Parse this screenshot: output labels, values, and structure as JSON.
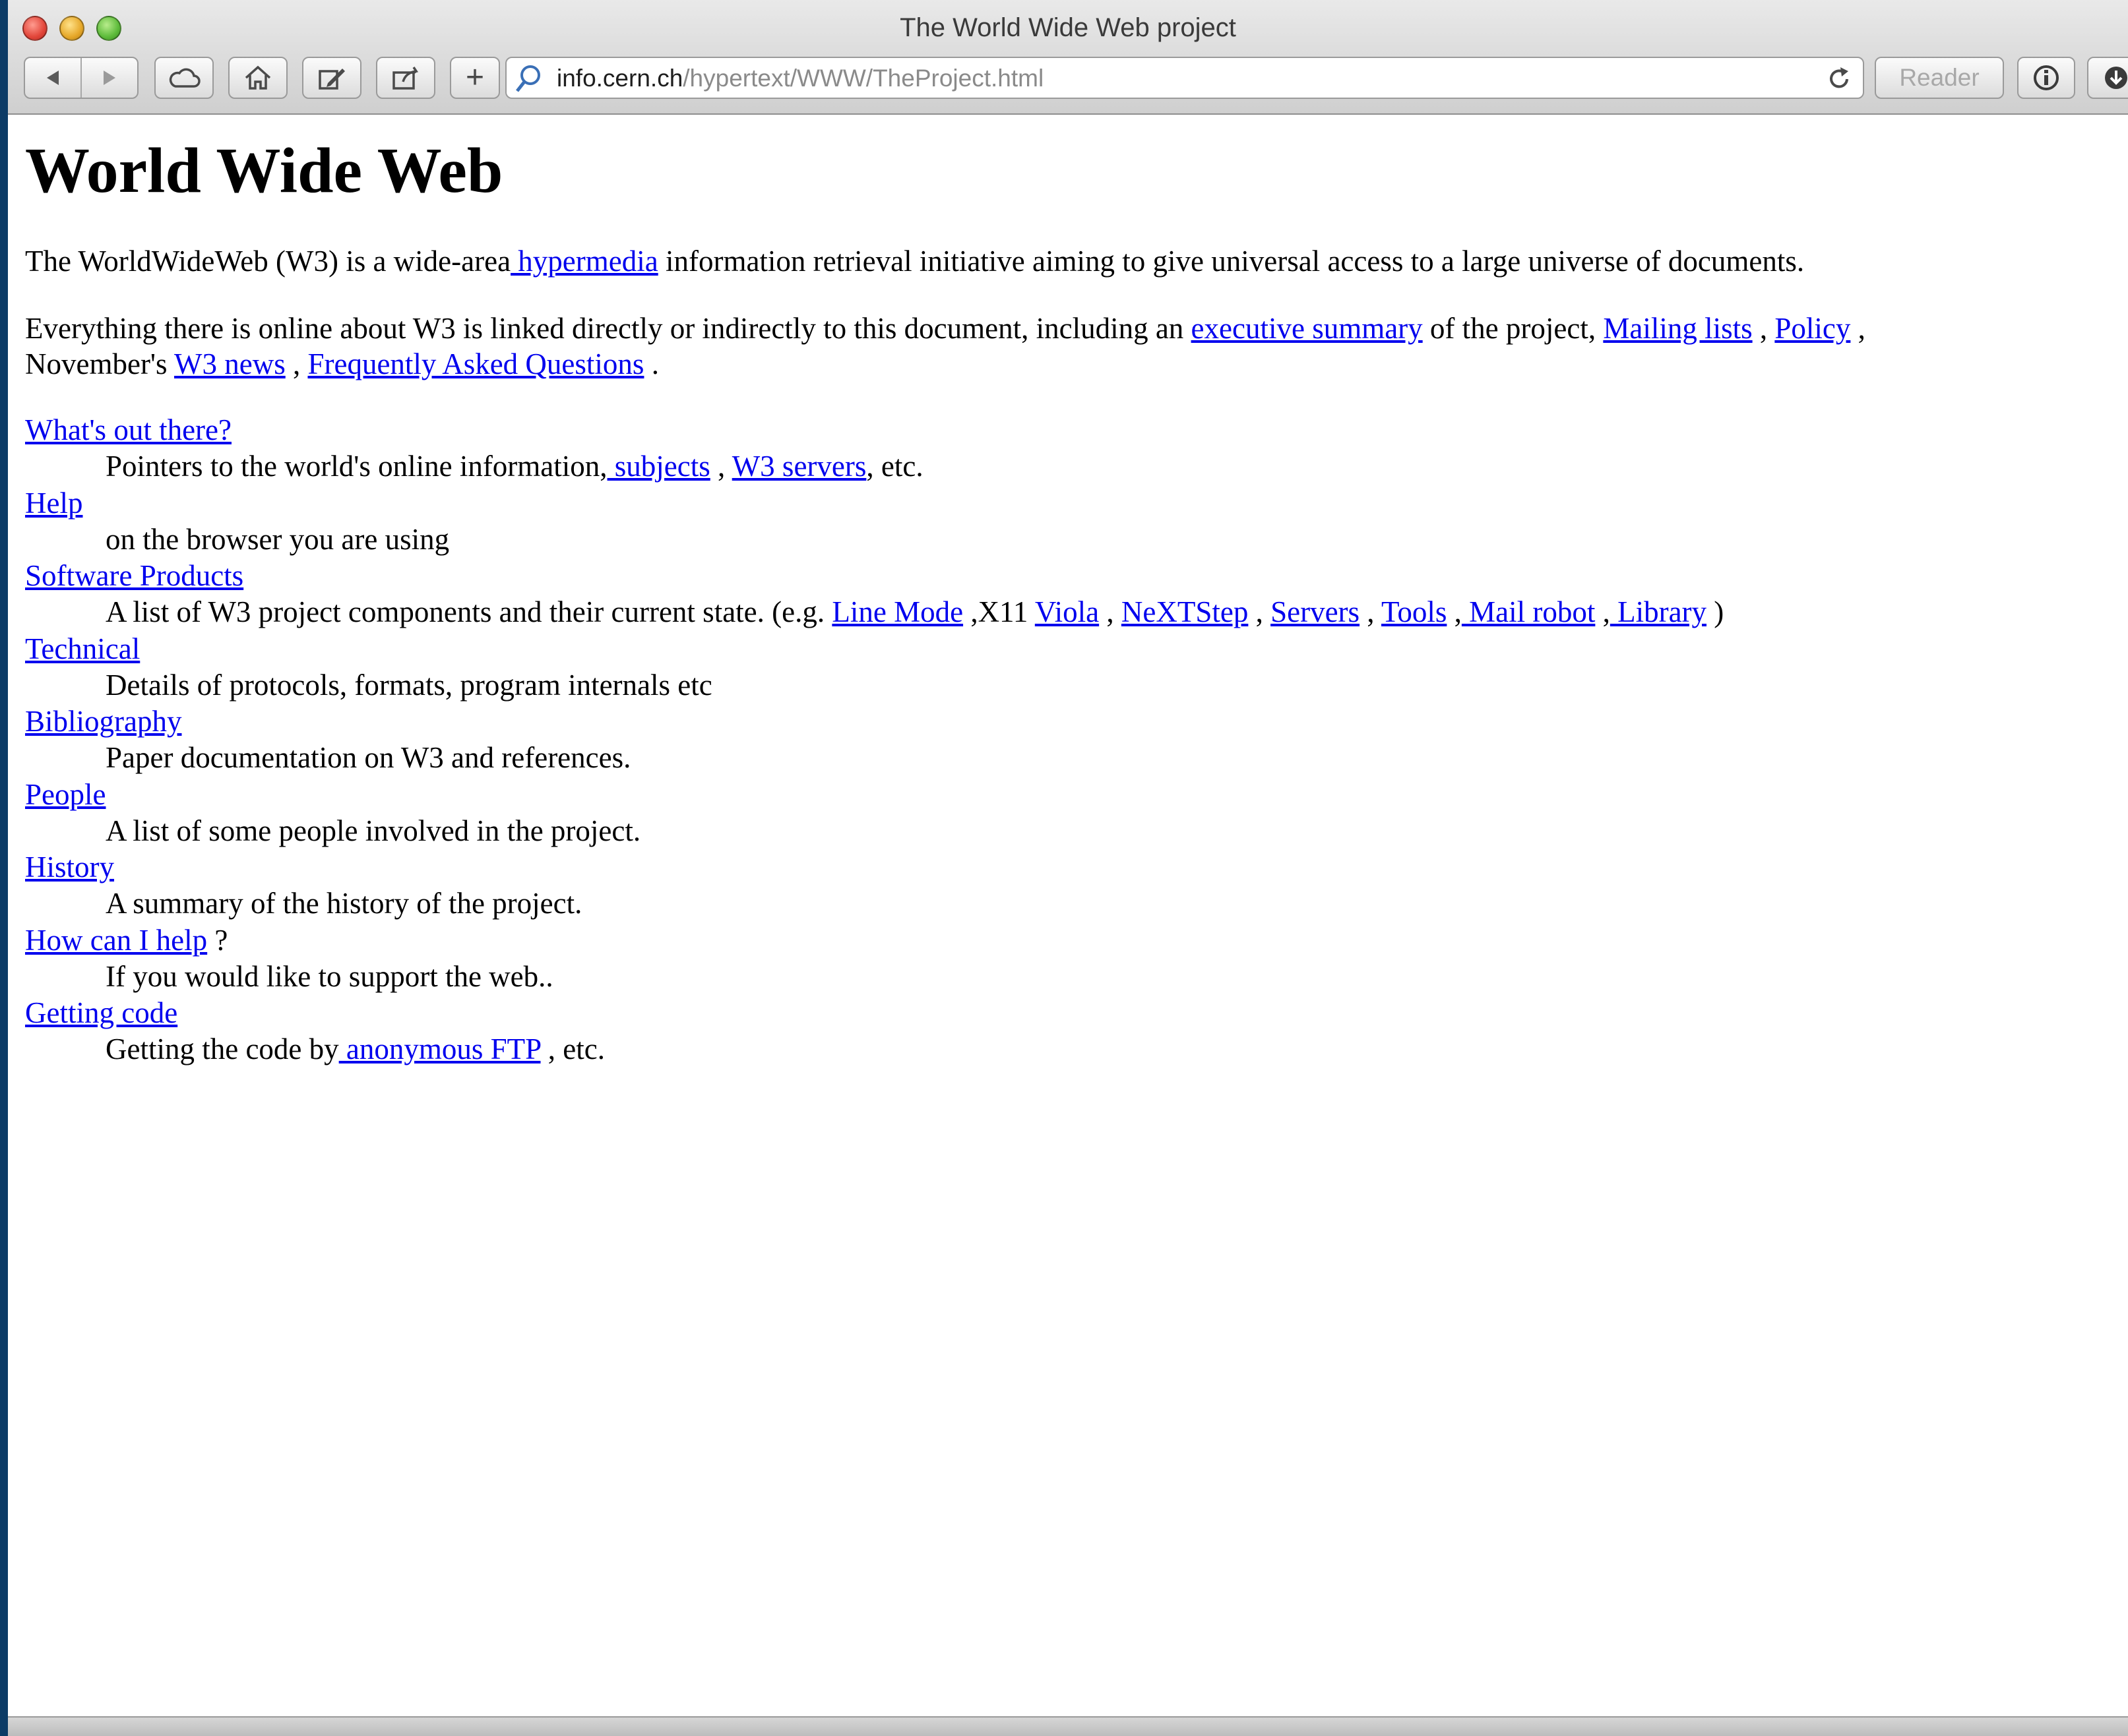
{
  "window": {
    "title": "The World Wide Web project"
  },
  "toolbar": {
    "address_host": "info.cern.ch",
    "address_path": "/hypertext/WWW/TheProject.html",
    "reader_label": "Reader",
    "add_label": "+"
  },
  "page": {
    "heading": "World Wide Web",
    "intro": {
      "before": "The WorldWideWeb (W3) is a wide-area",
      "link": " hypermedia",
      "after": " information retrieval initiative aiming to give universal access to a large universe of documents."
    },
    "para2": {
      "t1": "Everything there is online about W3 is linked directly or indirectly to this document, including an ",
      "l1": "executive summary",
      "t2": " of the project, ",
      "l2": "Mailing lists",
      "t3": " , ",
      "l3": "Policy",
      "t4": " ,",
      "t5": "November's ",
      "l4": "W3 news",
      "t6": " , ",
      "l5": "Frequently Asked Questions",
      "t7": " ."
    },
    "items": [
      {
        "term": "What's out there?",
        "desc": {
          "t1": "Pointers to the world's online information,",
          "l1": " subjects",
          "t2": " , ",
          "l2": "W3 servers",
          "t3": ", etc."
        }
      },
      {
        "term": "Help",
        "desc": {
          "t1": "on the browser you are using"
        }
      },
      {
        "term": "Software Products",
        "desc": {
          "t1": "A list of W3 project components and their current state. (e.g. ",
          "l1": "Line Mode",
          "t2": " ,X11 ",
          "l2": "Viola",
          "t3": " , ",
          "l3": "NeXTStep",
          "t4": " , ",
          "l4": "Servers",
          "t5": " , ",
          "l5": "Tools",
          "t6": " ,",
          "l6": " Mail robot",
          "t7": " ,",
          "l7": " Library",
          "t8": " )"
        }
      },
      {
        "term": "Technical",
        "desc": {
          "t1": "Details of protocols, formats, program internals etc"
        }
      },
      {
        "term": "Bibliography",
        "desc": {
          "t1": "Paper documentation on W3 and references."
        }
      },
      {
        "term": "People",
        "desc": {
          "t1": "A list of some people involved in the project."
        }
      },
      {
        "term": "History",
        "desc": {
          "t1": "A summary of the history of the project."
        }
      },
      {
        "term": "How can I help",
        "term_after": " ?",
        "desc": {
          "t1": "If you would like to support the web.."
        }
      },
      {
        "term": "Getting code",
        "desc": {
          "t1": "Getting the code by",
          "l1": " anonymous FTP",
          "t2": " , etc."
        }
      }
    ]
  },
  "colors": {
    "link": "#0000ee",
    "desktop": "#0c3b66"
  },
  "icons": [
    "close-button",
    "minimize-button",
    "zoom-button",
    "back-icon",
    "forward-icon",
    "icloud-tabs-icon",
    "home-icon",
    "edit-icon",
    "share-icon",
    "plus-icon",
    "search-icon",
    "reload-icon",
    "info-icon",
    "download-icon"
  ]
}
